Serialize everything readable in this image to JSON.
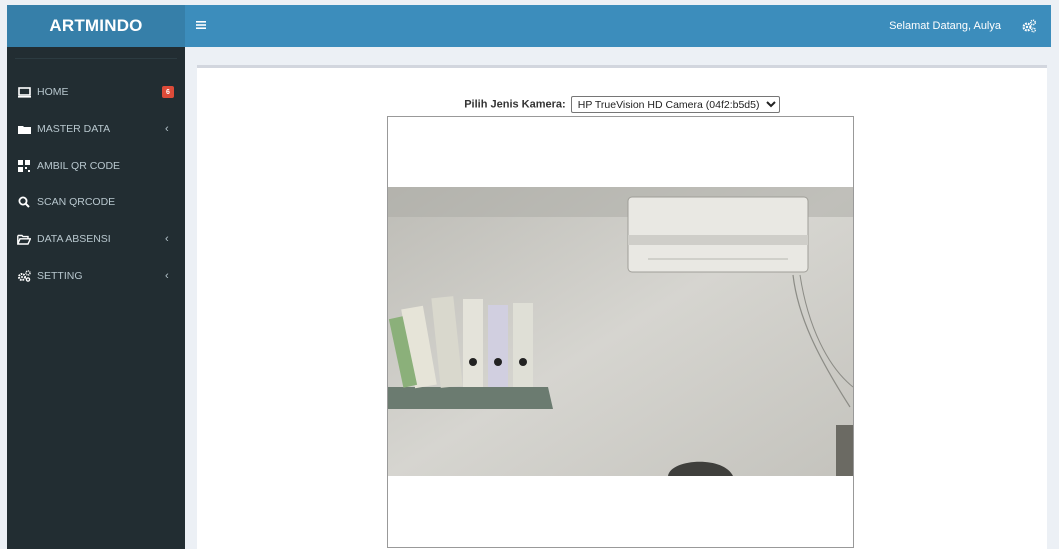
{
  "app": {
    "brand": "ARTMINDO"
  },
  "header": {
    "menu_icon": "hamburger-icon",
    "welcome": "Selamat Datang, Aulya",
    "settings_icon": "cogs-icon"
  },
  "sidebar": {
    "items": [
      {
        "label": "HOME",
        "icon": "desktop-icon",
        "badge": "6"
      },
      {
        "label": "MASTER DATA",
        "icon": "folder-icon",
        "chevron": "‹"
      },
      {
        "label": "AMBIL QR CODE",
        "icon": "qrcode-icon"
      },
      {
        "label": "SCAN QRCODE",
        "icon": "search-icon"
      },
      {
        "label": "DATA ABSENSI",
        "icon": "folder-open-icon",
        "chevron": "‹"
      },
      {
        "label": "SETTING",
        "icon": "cogs-icon",
        "chevron": "‹"
      }
    ]
  },
  "camera": {
    "label": "Pilih Jenis Kamera:",
    "selected": "HP TrueVision HD Camera (04f2:b5d5)"
  },
  "colors": {
    "header": "#3c8dbc",
    "logo": "#367fa9",
    "sidebar": "#222d32",
    "badge": "#dd4b39"
  }
}
